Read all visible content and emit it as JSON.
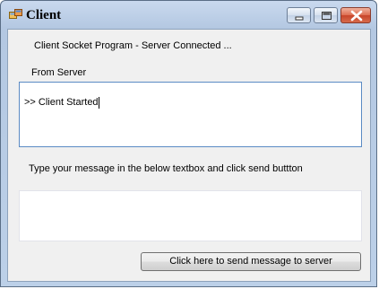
{
  "window": {
    "title": "Client",
    "controls": {
      "minimize": "minimize-icon",
      "maximize": "maximize-icon",
      "close": "close-icon"
    }
  },
  "labels": {
    "status": "Client Socket Program - Server Connected ...",
    "from_server": "From Server",
    "instruction": "Type your message in the  below textbox and click send buttton"
  },
  "server_output": {
    "text": ">> Client Started"
  },
  "message_input": {
    "value": ""
  },
  "send_button": {
    "label": "Click here to send message to server"
  },
  "colors": {
    "close_button": "#c8452b",
    "client_area": "#f0f0f0",
    "focused_border": "#5b8bc4"
  }
}
